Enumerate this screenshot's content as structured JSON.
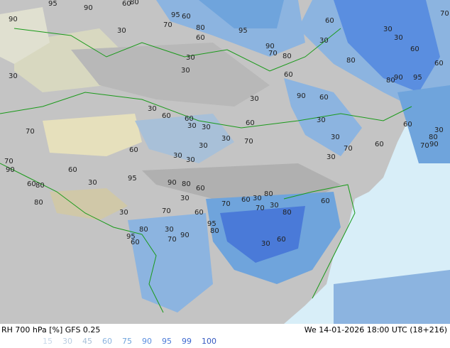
{
  "title": "RH 700 hPa [%] GFS 0.25",
  "timestamp": "We 14-01-2026 18:00 UTC (18+216)",
  "legend": [
    {
      "label": "15",
      "color": "#c8d8e8"
    },
    {
      "label": "30",
      "color": "#b8cce0"
    },
    {
      "label": "45",
      "color": "#a8c0d8"
    },
    {
      "label": "60",
      "color": "#8cb4e0"
    },
    {
      "label": "75",
      "color": "#6fa4dc"
    },
    {
      "label": "90",
      "color": "#5a8ee0"
    },
    {
      "label": "95",
      "color": "#4a7ad8"
    },
    {
      "label": "99",
      "color": "#3c68d0"
    },
    {
      "label": "100",
      "color": "#3458c0"
    }
  ],
  "contour_labels": [
    "95",
    "90",
    "60",
    "80",
    "90",
    "95",
    "60",
    "30",
    "70",
    "30",
    "60",
    "80",
    "95",
    "30",
    "90",
    "70",
    "80",
    "60",
    "30",
    "30",
    "60",
    "70",
    "60",
    "30",
    "30",
    "60",
    "80",
    "30",
    "30",
    "60",
    "60",
    "30",
    "30",
    "60",
    "70",
    "60",
    "30",
    "30",
    "30",
    "30",
    "70",
    "90",
    "60",
    "30",
    "30",
    "70",
    "60",
    "30",
    "80",
    "90",
    "95",
    "70",
    "60",
    "30",
    "80",
    "90",
    "70",
    "90",
    "60",
    "80",
    "60",
    "30",
    "95",
    "90",
    "80",
    "60",
    "30",
    "70",
    "60",
    "30",
    "80",
    "70",
    "30",
    "80",
    "60",
    "80",
    "30",
    "70",
    "60",
    "80",
    "30",
    "90",
    "95",
    "80",
    "95",
    "60",
    "70",
    "60",
    "30"
  ],
  "colors": {
    "land": "#c8c8c8",
    "sea": "#d8eef8",
    "border": "#1a9a1a",
    "coast": "#1a9a1a"
  }
}
